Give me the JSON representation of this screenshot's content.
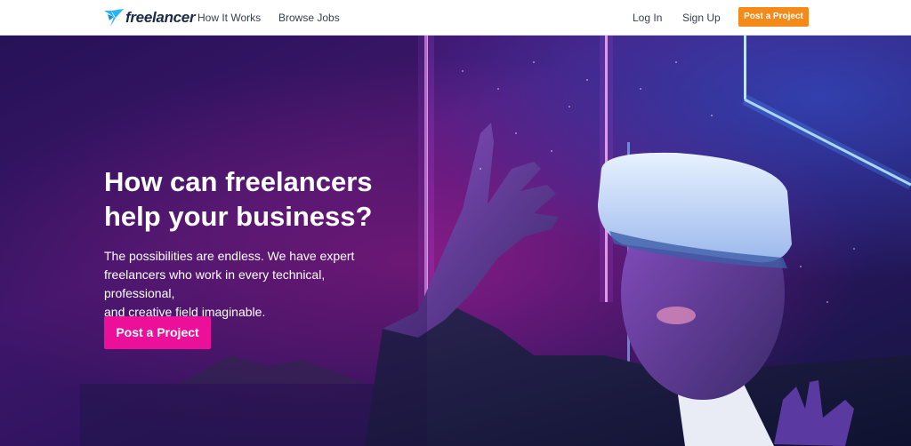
{
  "nav": {
    "logo_text": "freelancer",
    "links": [
      "How It Works",
      "Browse Jobs"
    ],
    "login": "Log In",
    "signup": "Sign Up",
    "post_project": "Post a Project"
  },
  "hero": {
    "title_line1": "How can freelancers",
    "title_line2": "help your business?",
    "subtitle_line1": "The possibilities are endless. We have expert",
    "subtitle_line2": "freelancers who work in every technical, professional,",
    "subtitle_line3": "and creative field imaginable.",
    "cta": "Post a Project"
  },
  "colors": {
    "orange": "#f38a1a",
    "pink": "#ec0f9a",
    "navy": "#1b2a48",
    "logo_blue": "#29b2fe"
  },
  "icons": {
    "logo": "freelancer-bird-icon"
  }
}
